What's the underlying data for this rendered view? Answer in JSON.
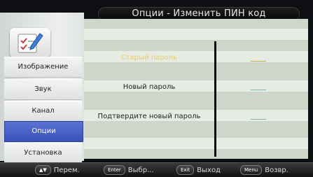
{
  "header": {
    "title": "Опции - Изменить ПИН код"
  },
  "sidebar": {
    "icon": "checklist-pencil-icon",
    "items": [
      {
        "label": "Изображение",
        "active": false
      },
      {
        "label": "Звук",
        "active": false
      },
      {
        "label": "Канал",
        "active": false
      },
      {
        "label": "Опции",
        "active": true
      },
      {
        "label": "Установка",
        "active": false
      }
    ]
  },
  "pin_form": {
    "old_pin": {
      "label": "Старый пароль",
      "value": "",
      "disabled": true
    },
    "new_pin": {
      "label": "Новый пароль",
      "value": ""
    },
    "confirm_pin": {
      "label": "Подтвердите новый пароль",
      "value": ""
    }
  },
  "help_bar": [
    {
      "key": "▲▼",
      "label": "Перем."
    },
    {
      "key": "Enter",
      "label": "Выбр..."
    },
    {
      "key": "Exit",
      "label": "Выход"
    },
    {
      "key": "Menu",
      "label": "Возвр."
    }
  ],
  "colors": {
    "accent": "#3a52b8",
    "panel": "#cdd6c9",
    "panel_stripe": "#e6ece3",
    "disabled_text": "#f0c23a",
    "value_line_old": "#c9a640",
    "value_line_new": "#7fb6a8"
  }
}
